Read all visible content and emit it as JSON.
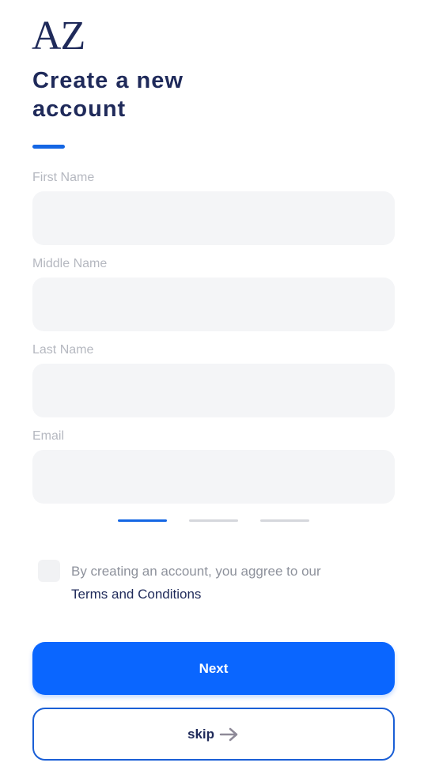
{
  "brand": {
    "logo_text": "AZ"
  },
  "header": {
    "title": "Create a new account"
  },
  "form": {
    "fields": [
      {
        "label": "First Name",
        "value": "",
        "placeholder": ""
      },
      {
        "label": "Middle Name",
        "value": "",
        "placeholder": ""
      },
      {
        "label": "Last Name",
        "value": "",
        "placeholder": ""
      },
      {
        "label": "Email",
        "value": "",
        "placeholder": ""
      }
    ]
  },
  "stepper": {
    "current_step": 1,
    "total_steps": 3
  },
  "consent": {
    "checked": false,
    "text": "By creating an account, you aggree to our",
    "link_text": "Terms and Conditions"
  },
  "actions": {
    "next_label": "Next",
    "skip_label": "skip"
  },
  "colors": {
    "primary": "#0a66ff",
    "accent": "#1466e4",
    "title": "#1f2a5a",
    "input_bg": "#f4f5f7",
    "label": "#b5b8c0"
  },
  "icons": {
    "skip": "arrow-right-icon"
  }
}
